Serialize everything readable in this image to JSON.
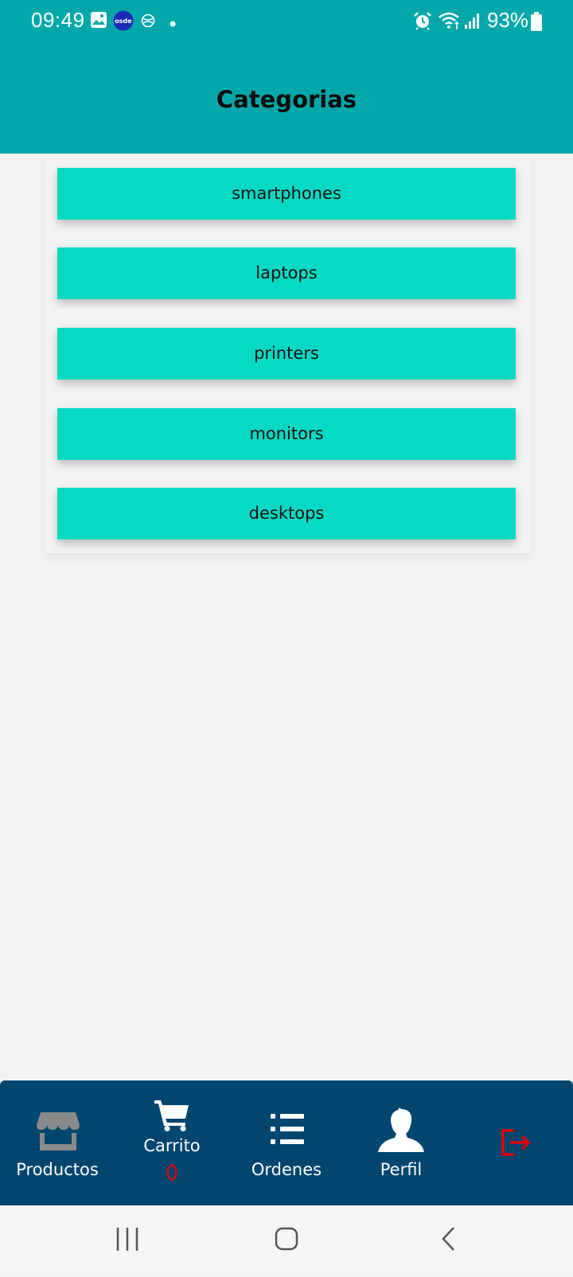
{
  "status_bar": {
    "time": "09:49",
    "notification_icons": [
      "gallery-icon",
      "osde-app-icon",
      "globe-icon",
      "dot-icon"
    ],
    "system_icons": [
      "alarm-icon",
      "wifi-icon",
      "signal-icon",
      "battery-icon"
    ],
    "battery_text": "93%"
  },
  "header": {
    "title": "Categorias",
    "background_color": "#02a8a9"
  },
  "categories": [
    {
      "label": "smartphones"
    },
    {
      "label": "laptops"
    },
    {
      "label": "printers"
    },
    {
      "label": "monitors"
    },
    {
      "label": "desktops"
    }
  ],
  "category_button_color": "#05d9c4",
  "bottom_nav": {
    "background_color": "#00466f",
    "items": [
      {
        "label": "Productos",
        "icon": "storefront-icon"
      },
      {
        "label": "Carrito",
        "icon": "cart-icon",
        "count": "0"
      },
      {
        "label": "Ordenes",
        "icon": "list-icon"
      },
      {
        "label": "Perfil",
        "icon": "person-icon"
      },
      {
        "label": "",
        "icon": "logout-icon"
      }
    ],
    "badge_color": "#e00000"
  },
  "system_nav": {
    "buttons": [
      "recent-apps-icon",
      "home-icon",
      "back-icon"
    ]
  }
}
